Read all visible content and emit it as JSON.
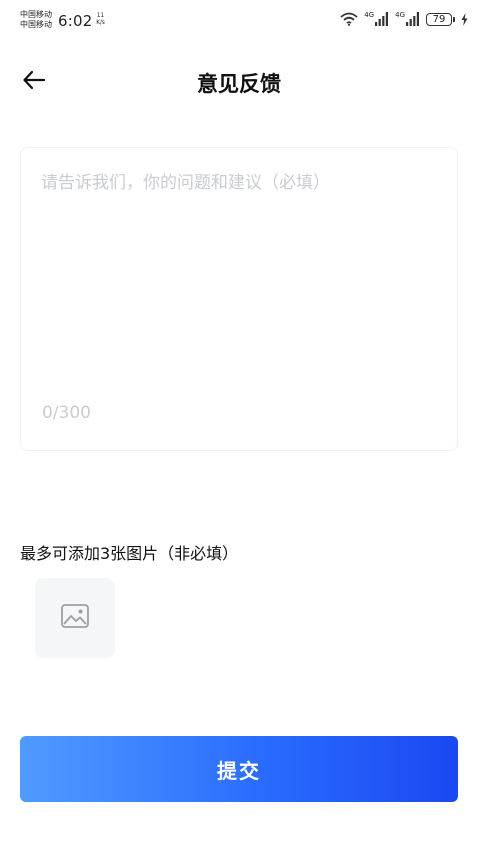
{
  "status_bar": {
    "carrier_1": "中国移动",
    "carrier_2": "中国移动",
    "time": "6:02",
    "net_speed_value": "11",
    "net_speed_unit": "K/s",
    "signal_1_label": "4G",
    "signal_2_label": "4G",
    "battery_level": "79",
    "icons": [
      "wifi-icon",
      "signal-icon",
      "signal-icon",
      "battery-icon",
      "charging-icon"
    ]
  },
  "header": {
    "back_icon": "arrow-left-icon",
    "title": "意见反馈"
  },
  "feedback": {
    "value": "",
    "placeholder": "请告诉我们，你的问题和建议（必填）",
    "counter": "0/300"
  },
  "images": {
    "label": "最多可添加3张图片（非必填）",
    "add_icon": "image-icon"
  },
  "submit": {
    "label": "提交"
  },
  "colors": {
    "button_gradient_start": "#4f9bff",
    "button_gradient_end": "#1a48f2",
    "placeholder_text": "#c9ccd1",
    "box_border": "#eef0f3",
    "image_slot_bg": "#f5f6f8"
  }
}
